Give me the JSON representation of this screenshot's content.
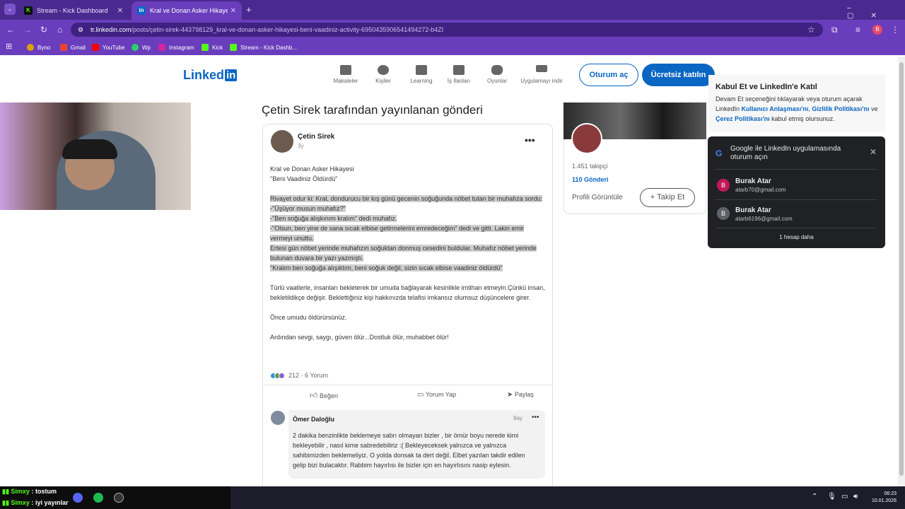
{
  "browser": {
    "tabs": [
      {
        "title": "Stream - Kick Dashboard",
        "favicon": "K"
      },
      {
        "title": "Kral ve Donan Asker Hikayesi \"B",
        "favicon": "in"
      }
    ],
    "new_tab": "+",
    "url_host": "tr.linkedin.com",
    "url_path": "/posts/çetin-sirek-443798129_kral-ve-donan-asker-hikayesi-beni-vaadiniz-activity-6950435906541494272-b4ZI",
    "profile_initial": "B",
    "bookmarks": [
      "Byno",
      "Gmail",
      "YouTube",
      "Wp",
      "Instagram",
      "Kick",
      "Stream - Kick Dashb..."
    ]
  },
  "linkedin": {
    "logo_text": "Linked",
    "logo_in": "in",
    "nav": [
      "Makaleler",
      "Kişiler",
      "Learning",
      "İş İlanları",
      "Oyunlar",
      "Uygulamayı indir"
    ],
    "signin": "Oturum aç",
    "join": "Ücretsiz katılın"
  },
  "page_title": "Çetin Sirek tarafından yayınlanan gönderi",
  "post": {
    "author": "Çetin Sirek",
    "age": "3y",
    "more": "•••",
    "title_line1": "Kral ve Donan Asker Hikayesi",
    "title_line2": "\"Beni Vaadiniz Öldürdü\"",
    "story": [
      "Rivayet odur ki: Kral, dondurucu bir kış günü gecenin soğuğunda nöbet tutan bir muhafıza sordu:",
      "-\"Üşüyor musun muhafız?\"",
      "-\"Ben soğuğa alışkınım kralım\" dedi muhafız.",
      "-\"Olsun, ben yine de sana sıcak elbise getirmelerini emredeceğim\" dedi ve gitti. Lakin emir vermeyi unuttu.",
      "Ertesi gün nöbet yerinde muhafızın soğuktan donmuş cesedini buldular. Muhafız nöbet yerinde bulunan duvara bir yazı yazmıştı.",
      "\"Kralım ben soğuğa alışıktım, beni soğuk değil, sizin sıcak elbise vaadiniz öldürdü\""
    ],
    "para1": "Türlü vaatlerle, insanları bekleterek bir umuda bağlayarak kesinlikle imtihan etmeyin.Çünkü insan, bekletildikçe değişir. Beklettiğiniz kişi hakkınızda telafisi imkansız olumsuz düşüncelere girer.",
    "para2": "Önce umudu öldürürsünüz.",
    "para3": "Ardından sevgi, saygı, güven ölür...Dostluk ölür, muhabbet ölür!",
    "reactions": "212 · 6 Yorum",
    "actions": [
      "Beğen",
      "Yorum Yap",
      "Paylaş"
    ]
  },
  "comment": {
    "author": "Ömer Daloğlu",
    "age": "8ay",
    "more": "•••",
    "text": "2 dakika benzinlikte beklemeye sabrı olmayan bizler , bir ömür boyu nerede kimi bekleyebilir , nasıl kime sabredebiliriz :( Bekleyeceksek yalnızca ve yalnızca sahibimizden beklemeliyiz. O yolda donsak ta dert değil. Elbet yazılan takdir edilen gelip bizi bulacaktır. Rabbim hayırlısı ile bizler için en hayırlısını nasip eylesin."
  },
  "profile_card": {
    "followers": "1.451 takipçi",
    "posts": "110 Gönderi",
    "view_profile": "Profili Görüntüle",
    "follow": "Takip Et"
  },
  "consent": {
    "title": "Kabul Et ve LinkedIn'e Katıl",
    "text_a": "Devam Et seçeneğini tıklayarak veya oturum açarak LinkedIn ",
    "link1": "Kullanıcı Anlaşması'nı",
    "sep1": ", ",
    "link2": "Gizlilik Politikası'nı",
    "text_b": " ve ",
    "link3": "Çerez Politikası'nı",
    "text_c": " kabul etmiş olursunuz."
  },
  "google_popup": {
    "title": "Google ile LinkedIn uygulamasında oturum açın",
    "accounts": [
      {
        "initial": "B",
        "name": "Burak Atar",
        "email": "atarb70@gmail.com",
        "color": "#c2185b"
      },
      {
        "initial": "B",
        "name": "Burak Atar",
        "email": "atarb6196@gmail.com",
        "color": "#5f6368"
      }
    ],
    "more": "1 hesap daha"
  },
  "taskbar": {
    "chat": [
      {
        "user": "Simxy",
        "msg": " : tostum"
      },
      {
        "user": "Simxy",
        "msg": " : iyi yayınlar"
      }
    ],
    "time": "06:23",
    "date": "10.01.2026"
  }
}
